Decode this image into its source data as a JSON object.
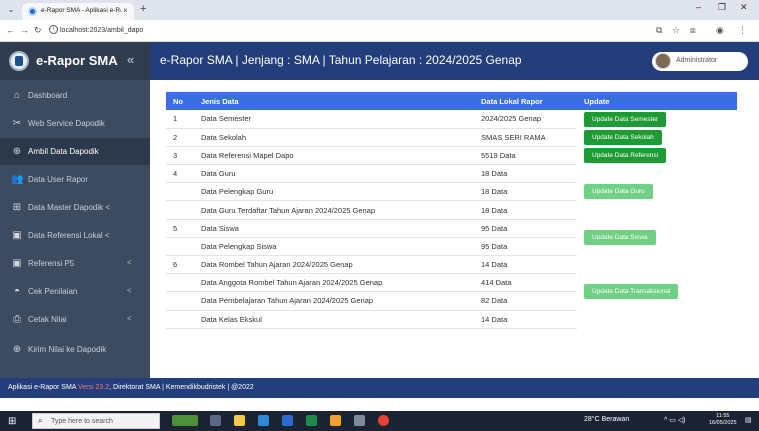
{
  "browser": {
    "tab_title": "e-Rapor SMA - Aplikasi e-Rapo",
    "tab_close": "×",
    "new_tab": "+",
    "url": "localhost:2023/ambil_dapo"
  },
  "header": {
    "app_name": "e-Rapor SMA",
    "collapse": "«",
    "title": "e-Rapor SMA | Jenjang : SMA | Tahun Pelajaran : 2024/2025 Genap",
    "user": "Administrator"
  },
  "sidebar": {
    "items": [
      {
        "label": "Dashboard",
        "icon": "home-icon"
      },
      {
        "label": "Web Service Dapodik",
        "icon": "tools-icon"
      },
      {
        "label": "Ambil Data Dapodik",
        "icon": "download-icon"
      },
      {
        "label": "Data User Rapor",
        "icon": "users-icon"
      },
      {
        "label": "Data Master Dapodik <",
        "icon": "database-icon"
      },
      {
        "label": "Data Referensi Lokal <",
        "icon": "briefcase-icon"
      },
      {
        "label": "Referensi P5",
        "icon": "briefcase-icon",
        "chevron": "<"
      },
      {
        "label": "Cek Penilaian",
        "icon": "car-icon",
        "chevron": "<"
      },
      {
        "label": "Cetak Nilai",
        "icon": "print-icon",
        "chevron": "<"
      },
      {
        "label": "Kirim Nilai ke Dapodik",
        "icon": "upload-icon"
      }
    ]
  },
  "table": {
    "headers": {
      "no": "No",
      "jenis": "Jenis Data",
      "lokal": "Data Lokal Rapor",
      "update": "Update"
    },
    "rows": [
      {
        "no": "1",
        "jenis": "Data Semester",
        "lokal": "2024/2025 Genap"
      },
      {
        "no": "2",
        "jenis": "Data Sekolah",
        "lokal": "SMAS SERI RAMA"
      },
      {
        "no": "3",
        "jenis": "Data Referensi Mapel Dapo",
        "lokal": "5519 Data"
      },
      {
        "no": "4",
        "jenis": "Data Guru",
        "lokal": "18 Data"
      },
      {
        "no": "",
        "jenis": "Data Pelengkap Guru",
        "lokal": "18 Data"
      },
      {
        "no": "",
        "jenis": "Data Guru Terdaftar Tahun Ajaran 2024/2025 Genap",
        "lokal": "18 Data"
      },
      {
        "no": "5",
        "jenis": "Data Siswa",
        "lokal": "95 Data"
      },
      {
        "no": "",
        "jenis": "Data Pelengkap Siswa",
        "lokal": "95 Data"
      },
      {
        "no": "6",
        "jenis": "Data Rombel Tahun Ajaran 2024/2025 Genap",
        "lokal": "14 Data"
      },
      {
        "no": "",
        "jenis": "Data Anggota Rombel Tahun Ajaran 2024/2025 Genap",
        "lokal": "414 Data"
      },
      {
        "no": "",
        "jenis": "Data Pembelajaran Tahun Ajaran 2024/2025 Genap",
        "lokal": "82 Data"
      },
      {
        "no": "",
        "jenis": "Data Kelas Ekskul",
        "lokal": "14 Data"
      }
    ],
    "buttons": {
      "semester": "Update Data Semester",
      "sekolah": "Update Data Sekolah",
      "referensi": "Update Data Referensi",
      "guru": "Update Data Guru",
      "siswa": "Update Data Siswa",
      "transaksional": "Update Data Transaksional"
    }
  },
  "footer": {
    "prefix": "Aplikasi e-Rapor SMA ",
    "version": "Versi 23.2",
    "suffix": ", Direktorat SMA | Kemendikbudristek | @2022"
  },
  "taskbar": {
    "search_placeholder": "Type here to search",
    "weather": "28°C  Berawan",
    "time": "11:55",
    "date": "16/05/2025"
  },
  "colors": {
    "topbar": "#233e7a",
    "sidebar": "#3c4b5f",
    "table_header": "#3b6fe0",
    "button_dark": "#1e9b34",
    "button_light": "#6fd086"
  }
}
